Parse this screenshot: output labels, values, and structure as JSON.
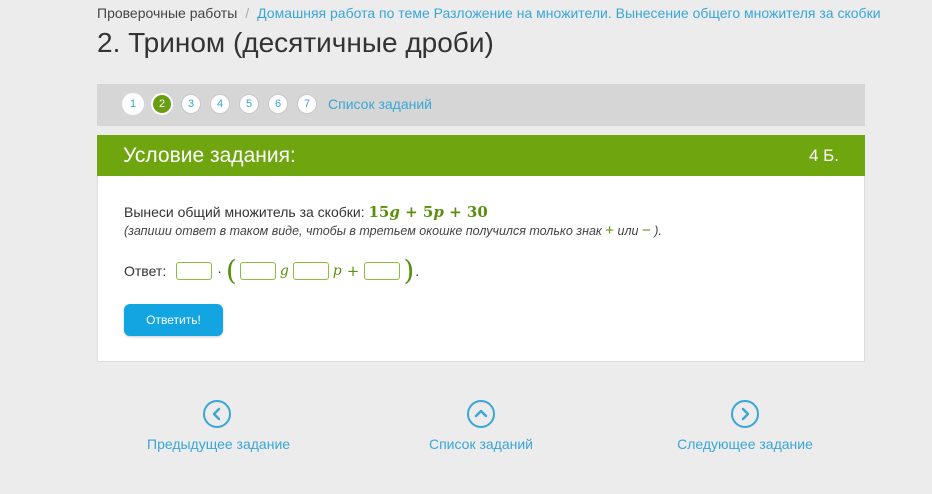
{
  "breadcrumb": {
    "root": "Проверочные работы",
    "separator": "/",
    "current": "Домашняя работа по теме Разложение на множители. Вынесение общего множителя за скобки"
  },
  "page_title": "2. Трином (десятичные дроби)",
  "pager": {
    "numbers": [
      "1",
      "2",
      "3",
      "4",
      "5",
      "6",
      "7"
    ],
    "active": "2",
    "task_list_label": "Список заданий"
  },
  "task": {
    "header_title": "Условие задания:",
    "points": "4 Б.",
    "condition_text": "Вынеси общий множитель за скобки:",
    "expression": {
      "c1": "15",
      "v1": "g",
      "plus1": "+",
      "c2": "5",
      "v2": "p",
      "plus2": "+",
      "c3": "30"
    },
    "note_prefix": "(запиши ответ в таком виде, чтобы в третьем окошке получился только знак",
    "note_plus": "+",
    "note_or": "или",
    "note_minus": "−",
    "note_suffix": ").",
    "answer_label": "Ответ:",
    "answer_symbols": {
      "dot": "·",
      "open_paren": "(",
      "var_g": "g",
      "var_p": "p",
      "plus": "+",
      "close_paren": ")",
      "period": "."
    },
    "submit_label": "Ответить!"
  },
  "bottom_nav": {
    "prev_label": "Предыдущее задание",
    "list_label": "Список заданий",
    "next_label": "Следующее задание",
    "prev_icon": "chevron-left-icon",
    "list_icon": "chevron-up-icon",
    "next_icon": "chevron-right-icon"
  },
  "colors": {
    "accent_green": "#6fa610",
    "link_blue": "#3aa6d6",
    "button_blue": "#13a4e2"
  }
}
